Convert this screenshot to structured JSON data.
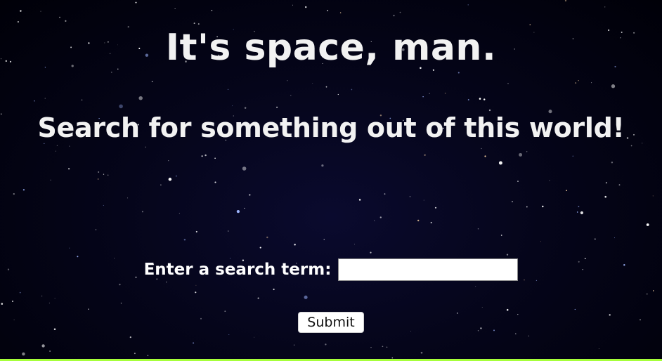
{
  "page": {
    "title": "It's space, man.",
    "subtitle": "Search for something out of this world!"
  },
  "search": {
    "label": "Enter a search term:",
    "value": "",
    "placeholder": ""
  },
  "submit": {
    "label": "Submit"
  },
  "colors": {
    "background": "#000008",
    "text": "#f2f2f2",
    "bottom_bar": "#a6ff3a"
  }
}
